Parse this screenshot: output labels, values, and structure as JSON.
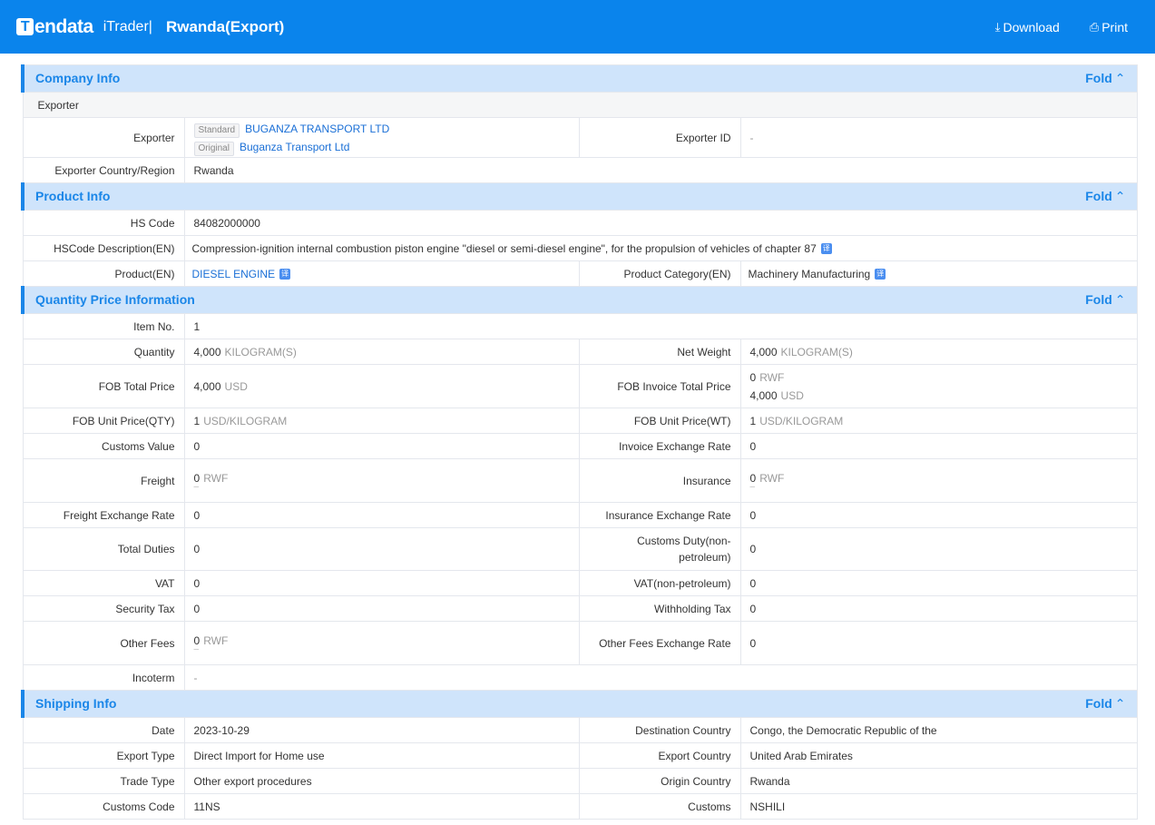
{
  "header": {
    "logo_mark": "T",
    "logo_text": "endata",
    "product": "iTrader|",
    "title": "Rwanda(Export)",
    "download_label": "Download",
    "print_label": "Print",
    "brand_color": "#0a84ec"
  },
  "fold_label": "Fold",
  "company": {
    "title": "Company Info",
    "sub_title": "Exporter",
    "exporter_label": "Exporter",
    "standard_tag": "Standard",
    "standard_name": "BUGANZA TRANSPORT LTD",
    "original_tag": "Original",
    "original_name": "Buganza Transport Ltd",
    "exporter_id_label": "Exporter ID",
    "exporter_id_value": "-",
    "country_label": "Exporter Country/Region",
    "country_value": "Rwanda"
  },
  "product": {
    "title": "Product Info",
    "hs_code_label": "HS Code",
    "hs_code_value": "84082000000",
    "hs_desc_label": "HSCode Description(EN)",
    "hs_desc_value": "Compression-ignition internal combustion piston engine \"diesel or semi-diesel engine\", for the propulsion of vehicles of chapter 87",
    "product_label": "Product(EN)",
    "product_value": "DIESEL ENGINE",
    "category_label": "Product Category(EN)",
    "category_value": "Machinery Manufacturing"
  },
  "quantity": {
    "title": "Quantity Price Information",
    "item_no_label": "Item No.",
    "item_no_value": "1",
    "quantity_label": "Quantity",
    "quantity_value": "4,000",
    "quantity_unit": "KILOGRAM(S)",
    "net_weight_label": "Net Weight",
    "net_weight_value": "4,000",
    "net_weight_unit": "KILOGRAM(S)",
    "fob_total_label": "FOB Total Price",
    "fob_total_value": "4,000",
    "fob_total_unit": "USD",
    "fob_invoice_label": "FOB Invoice Total Price",
    "fob_invoice_value1": "0",
    "fob_invoice_unit1": "RWF",
    "fob_invoice_value2": "4,000",
    "fob_invoice_unit2": "USD",
    "fob_unit_qty_label": "FOB Unit Price(QTY)",
    "fob_unit_qty_value": "1",
    "fob_unit_qty_unit": "USD/KILOGRAM",
    "fob_unit_wt_label": "FOB Unit Price(WT)",
    "fob_unit_wt_value": "1",
    "fob_unit_wt_unit": "USD/KILOGRAM",
    "customs_value_label": "Customs Value",
    "customs_value_value": "0",
    "invoice_rate_label": "Invoice Exchange Rate",
    "invoice_rate_value": "0",
    "freight_label": "Freight",
    "freight_value": "0",
    "freight_unit": "RWF",
    "insurance_label": "Insurance",
    "insurance_value": "0",
    "insurance_unit": "RWF",
    "freight_rate_label": "Freight Exchange Rate",
    "freight_rate_value": "0",
    "insurance_rate_label": "Insurance Exchange Rate",
    "insurance_rate_value": "0",
    "total_duties_label": "Total Duties",
    "total_duties_value": "0",
    "customs_duty_label": "Customs Duty(non-petroleum)",
    "customs_duty_value": "0",
    "vat_label": "VAT",
    "vat_value": "0",
    "vat_np_label": "VAT(non-petroleum)",
    "vat_np_value": "0",
    "security_tax_label": "Security Tax",
    "security_tax_value": "0",
    "withholding_label": "Withholding Tax",
    "withholding_value": "0",
    "other_fees_label": "Other Fees",
    "other_fees_value": "0",
    "other_fees_unit": "RWF",
    "other_fees_rate_label": "Other Fees Exchange Rate",
    "other_fees_rate_value": "0",
    "incoterm_label": "Incoterm",
    "incoterm_value": "-"
  },
  "shipping": {
    "title": "Shipping Info",
    "date_label": "Date",
    "date_value": "2023-10-29",
    "dest_label": "Destination Country",
    "dest_value": "Congo, the Democratic Republic of the",
    "export_type_label": "Export Type",
    "export_type_value": "Direct Import for Home use",
    "export_country_label": "Export Country",
    "export_country_value": "United Arab Emirates",
    "trade_type_label": "Trade Type",
    "trade_type_value": "Other export procedures",
    "origin_label": "Origin Country",
    "origin_value": "Rwanda",
    "customs_code_label": "Customs Code",
    "customs_code_value": "11NS",
    "customs_label": "Customs",
    "customs_value": "NSHILI"
  }
}
